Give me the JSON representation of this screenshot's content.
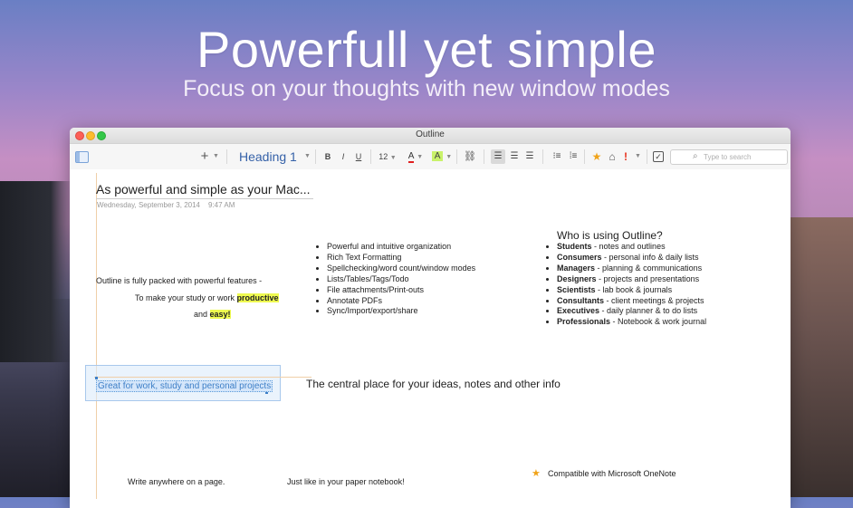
{
  "hero": {
    "title": "Powerfull yet simple",
    "subtitle": "Focus on your thoughts with new window modes"
  },
  "window": {
    "title": "Outline"
  },
  "toolbar": {
    "add_label": "+",
    "style_value": "Heading 1",
    "bold": "B",
    "italic": "I",
    "underline": "U",
    "font_size": "12",
    "font_color_letter": "A",
    "highlight_letter": "A",
    "search_placeholder": "Type to search",
    "icons": [
      "sidebar-toggle-icon",
      "add-icon",
      "link-icon",
      "align-left-icon",
      "align-center-icon",
      "align-right-icon",
      "bullet-list-icon",
      "numbered-list-icon",
      "star-icon",
      "home-icon",
      "important-icon",
      "checkbox-icon",
      "search-icon"
    ],
    "colors": {
      "font_color": "#e02020",
      "highlight": "#c9f26a",
      "star": "#f0a319",
      "important": "#e8321f"
    }
  },
  "page": {
    "title": "As powerful and simple as your Mac...",
    "date": "Wednesday, September 3, 2014",
    "time": "9:47 AM",
    "note1": {
      "line1": "Outline is fully packed with powerful features -",
      "line2_prefix": "To make your study or work ",
      "line2_highlight": "productive",
      "line3_prefix": "and ",
      "line3_highlight": "easy!"
    },
    "features": [
      "Powerful and intuitive organization",
      "Rich Text Formatting",
      "Spellchecking/word count/window modes",
      "Lists/Tables/Tags/Todo",
      "File attachments/Print-outs",
      "Annotate PDFs",
      "Sync/Import/export/share"
    ],
    "who": {
      "title": "Who is using Outline?",
      "items": [
        {
          "role": "Students",
          "desc": " - notes and outlines"
        },
        {
          "role": "Consumers",
          "desc": " - personal info & daily lists"
        },
        {
          "role": "Managers",
          "desc": " - planning & communications"
        },
        {
          "role": "Designers",
          "desc": " - projects and presentations"
        },
        {
          "role": "Scientists",
          "desc": " - lab book & journals"
        },
        {
          "role": "Consultants",
          "desc": " - client meetings & projects"
        },
        {
          "role": "Executives",
          "desc": " - daily planner & to do lists"
        },
        {
          "role": "Professionals",
          "desc": " - Notebook & work journal"
        }
      ]
    },
    "selected_note": "Great for work, study and personal projects",
    "central_note": "The central place for your ideas, notes and other info",
    "bottom": {
      "note1": "Write anywhere on a page.",
      "note2": "Just like in your paper notebook!",
      "note3": "Compatible with Microsoft OneNote"
    }
  }
}
